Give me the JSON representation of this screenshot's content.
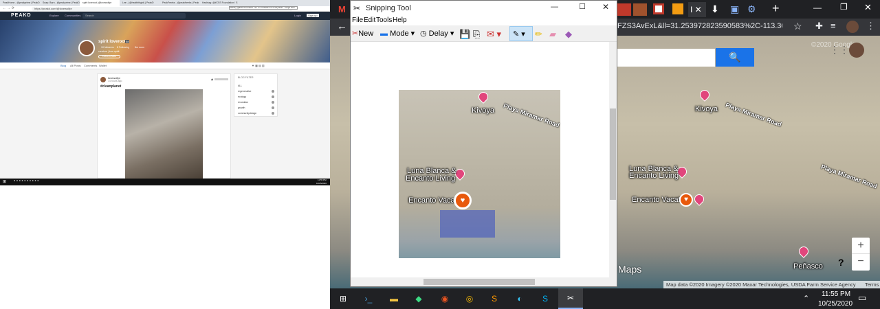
{
  "left_screenshot": {
    "browser_tabs": [
      "PeakHome - @peakprime | PeakD",
      "Snap: Barn - @peakprime | PeakD",
      "spirit loveroot (@lovewolfpr",
      "Lee - (@healththght) | PeakD",
      "PeakFreeks - @peakfreeks | Peak",
      "Hashtag: @#CSS Foundation / S"
    ],
    "active_tab": 2,
    "address": "https://peakd.com/@lovewolfpr",
    "tooltip": "Hashtag: @#CSS Foundation / S 1 2-3: CANVAS Community Build... Google Docs",
    "site_logo": "PEAKD",
    "site_nav": [
      "Explore",
      "Communities"
    ],
    "search_placeholder": "Search",
    "login": "Login",
    "signup": "Sign up",
    "profile": {
      "name": "spirit loveroot",
      "rep": "58",
      "followers": "10 followers",
      "following": "8 Following",
      "extra": "fbe room",
      "bio": "creature | love spirit",
      "follow_button": "Follow or Mute"
    },
    "profile_tabs": [
      "Blog",
      "All Posts",
      "Comments",
      "Wallet"
    ],
    "post": {
      "author": "lovewolfpr",
      "age": "14 hours ago",
      "tag": "#cleanplanet"
    },
    "blog_filter": {
      "title": "BLOG FILTER",
      "items": [
        "ALL",
        "regenerative",
        "ecology",
        "revolution",
        "growth",
        "communitydesign"
      ]
    },
    "taskbar_time": "11:55 PM",
    "taskbar_date": "10/25/2020"
  },
  "browser": {
    "address_fragment": "FZS3AvExL&ll=31.253972823590583%2C-113.30058...",
    "map": {
      "place_labels": [
        "Kivoya",
        "Luna Blanca & Encanto Living",
        "Encanto Vacat",
        "Peñasco"
      ],
      "road_labels": [
        "Playa Miramar Road",
        "Playa Miramar Road"
      ],
      "logo_text": "Maps",
      "attribution": "Map data ©2020 Imagery ©2020 Maxar Technologies, USDA Farm Service Agency",
      "terms": "Terms",
      "zoom_in": "+",
      "zoom_out": "−",
      "help": "?",
      "watermark": "©2020 Google"
    }
  },
  "snipping_tool": {
    "title": "Snipping Tool",
    "menu": [
      "File",
      "Edit",
      "Tools",
      "Help"
    ],
    "toolbar": {
      "new": "New",
      "mode": "Mode",
      "delay": "Delay"
    },
    "snip_labels": {
      "kivoya": "Kivoya",
      "road": "Playa Miramar Road",
      "luna": "Luna Blanca &",
      "luna2": "Encanto Living",
      "encanto": "Encanto Vacat"
    }
  },
  "taskbar": {
    "time": "11:55 PM",
    "date": "10/25/2020"
  }
}
